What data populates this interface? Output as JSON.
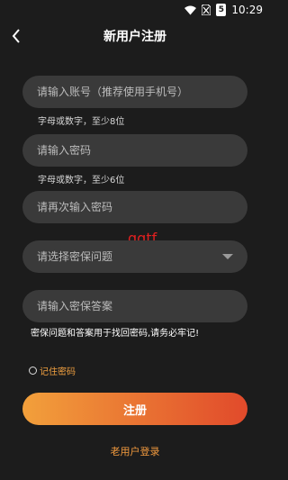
{
  "status_bar": {
    "time": "10:29",
    "battery_level": "5"
  },
  "header": {
    "title": "新用户注册"
  },
  "form": {
    "account": {
      "placeholder": "请输入账号（推荐使用手机号）",
      "hint": "字母或数字，至少8位"
    },
    "password": {
      "placeholder": "请输入密码",
      "hint": "字母或数字，至少6位"
    },
    "confirm_password": {
      "placeholder": "请再次输入密码"
    },
    "security_question": {
      "placeholder": "请选择密保问题"
    },
    "security_answer": {
      "placeholder": "请输入密保答案"
    },
    "warning": "密保问题和答案用于找回密码,请务必牢记!",
    "remember_label": "记住密码",
    "remember_checked": false
  },
  "watermark": "qqtf",
  "register_button": "注册",
  "login_link": "老用户登录",
  "colors": {
    "accent": "#f29a3e",
    "button_start": "#f2a03b",
    "button_end": "#e14a2b"
  }
}
